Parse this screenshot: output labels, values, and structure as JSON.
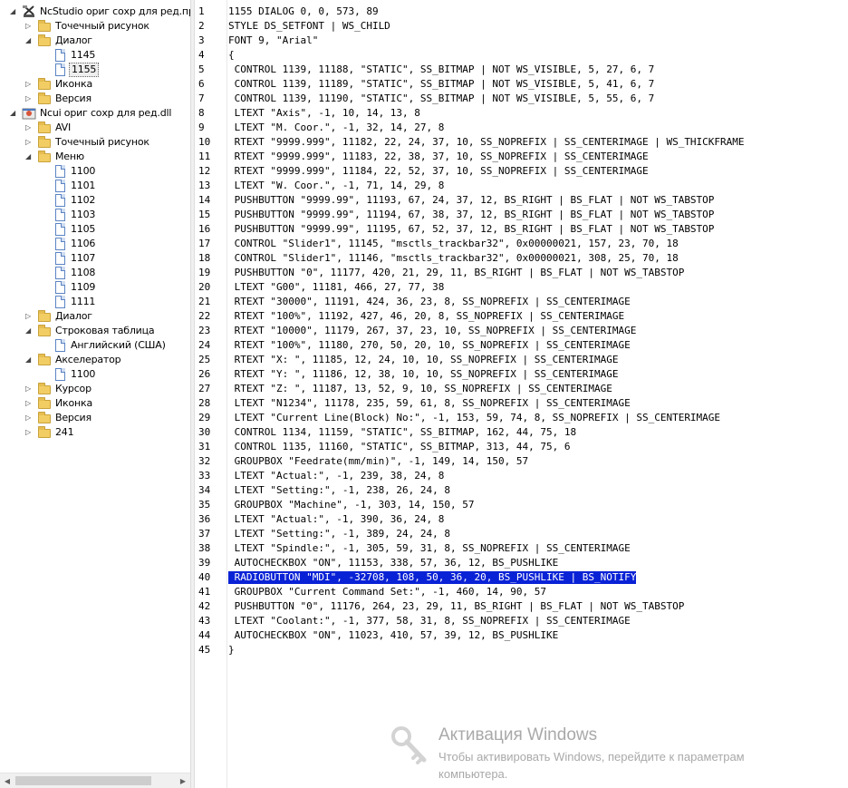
{
  "tree": {
    "items": [
      {
        "label": "NcStudio ориг сохр для ред.проб",
        "level": 0,
        "type": "app",
        "expanded": true
      },
      {
        "label": "Точечный рисунок",
        "level": 1,
        "type": "folder",
        "expanded": false
      },
      {
        "label": "Диалог",
        "level": 1,
        "type": "folder",
        "expanded": true
      },
      {
        "label": "1145",
        "level": 2,
        "type": "doc"
      },
      {
        "label": "1155",
        "level": 2,
        "type": "doc",
        "selected": true
      },
      {
        "label": "Иконка",
        "level": 1,
        "type": "folder",
        "expanded": false
      },
      {
        "label": "Версия",
        "level": 1,
        "type": "folder",
        "expanded": false
      },
      {
        "label": "Ncui ориг сохр для ред.dll",
        "level": 0,
        "type": "app2",
        "expanded": true
      },
      {
        "label": "AVI",
        "level": 1,
        "type": "folder",
        "expanded": false
      },
      {
        "label": "Точечный рисунок",
        "level": 1,
        "type": "folder",
        "expanded": false
      },
      {
        "label": "Меню",
        "level": 1,
        "type": "folder",
        "expanded": true
      },
      {
        "label": "1100",
        "level": 2,
        "type": "doc"
      },
      {
        "label": "1101",
        "level": 2,
        "type": "doc"
      },
      {
        "label": "1102",
        "level": 2,
        "type": "doc"
      },
      {
        "label": "1103",
        "level": 2,
        "type": "doc"
      },
      {
        "label": "1105",
        "level": 2,
        "type": "doc"
      },
      {
        "label": "1106",
        "level": 2,
        "type": "doc"
      },
      {
        "label": "1107",
        "level": 2,
        "type": "doc"
      },
      {
        "label": "1108",
        "level": 2,
        "type": "doc"
      },
      {
        "label": "1109",
        "level": 2,
        "type": "doc"
      },
      {
        "label": "1111",
        "level": 2,
        "type": "doc"
      },
      {
        "label": "Диалог",
        "level": 1,
        "type": "folder",
        "expanded": false
      },
      {
        "label": "Строковая таблица",
        "level": 1,
        "type": "folder",
        "expanded": true
      },
      {
        "label": "Английский (США)",
        "level": 2,
        "type": "doc"
      },
      {
        "label": "Акселератор",
        "level": 1,
        "type": "folder",
        "expanded": true
      },
      {
        "label": "1100",
        "level": 2,
        "type": "doc"
      },
      {
        "label": "Курсор",
        "level": 1,
        "type": "folder",
        "expanded": false
      },
      {
        "label": "Иконка",
        "level": 1,
        "type": "folder",
        "expanded": false
      },
      {
        "label": "Версия",
        "level": 1,
        "type": "folder",
        "expanded": false
      },
      {
        "label": "241",
        "level": 1,
        "type": "folder",
        "expanded": false
      }
    ]
  },
  "editor": {
    "selected_line": 40,
    "lines": [
      "1155 DIALOG 0, 0, 573, 89",
      "STYLE DS_SETFONT | WS_CHILD",
      "FONT 9, \"Arial\"",
      "{",
      " CONTROL 1139, 11188, \"STATIC\", SS_BITMAP | NOT WS_VISIBLE, 5, 27, 6, 7",
      " CONTROL 1139, 11189, \"STATIC\", SS_BITMAP | NOT WS_VISIBLE, 5, 41, 6, 7",
      " CONTROL 1139, 11190, \"STATIC\", SS_BITMAP | NOT WS_VISIBLE, 5, 55, 6, 7",
      " LTEXT \"Axis\", -1, 10, 14, 13, 8",
      " LTEXT \"M. Coor.\", -1, 32, 14, 27, 8",
      " RTEXT \"9999.999\", 11182, 22, 24, 37, 10, SS_NOPREFIX | SS_CENTERIMAGE | WS_THICKFRAME",
      " RTEXT \"9999.999\", 11183, 22, 38, 37, 10, SS_NOPREFIX | SS_CENTERIMAGE",
      " RTEXT \"9999.999\", 11184, 22, 52, 37, 10, SS_NOPREFIX | SS_CENTERIMAGE",
      " LTEXT \"W. Coor.\", -1, 71, 14, 29, 8",
      " PUSHBUTTON \"9999.99\", 11193, 67, 24, 37, 12, BS_RIGHT | BS_FLAT | NOT WS_TABSTOP",
      " PUSHBUTTON \"9999.99\", 11194, 67, 38, 37, 12, BS_RIGHT | BS_FLAT | NOT WS_TABSTOP",
      " PUSHBUTTON \"9999.99\", 11195, 67, 52, 37, 12, BS_RIGHT | BS_FLAT | NOT WS_TABSTOP",
      " CONTROL \"Slider1\", 11145, \"msctls_trackbar32\", 0x00000021, 157, 23, 70, 18",
      " CONTROL \"Slider1\", 11146, \"msctls_trackbar32\", 0x00000021, 308, 25, 70, 18",
      " PUSHBUTTON \"0\", 11177, 420, 21, 29, 11, BS_RIGHT | BS_FLAT | NOT WS_TABSTOP",
      " LTEXT \"G00\", 11181, 466, 27, 77, 38",
      " RTEXT \"30000\", 11191, 424, 36, 23, 8, SS_NOPREFIX | SS_CENTERIMAGE",
      " RTEXT \"100%\", 11192, 427, 46, 20, 8, SS_NOPREFIX | SS_CENTERIMAGE",
      " RTEXT \"10000\", 11179, 267, 37, 23, 10, SS_NOPREFIX | SS_CENTERIMAGE",
      " RTEXT \"100%\", 11180, 270, 50, 20, 10, SS_NOPREFIX | SS_CENTERIMAGE",
      " RTEXT \"X: \", 11185, 12, 24, 10, 10, SS_NOPREFIX | SS_CENTERIMAGE",
      " RTEXT \"Y: \", 11186, 12, 38, 10, 10, SS_NOPREFIX | SS_CENTERIMAGE",
      " RTEXT \"Z: \", 11187, 13, 52, 9, 10, SS_NOPREFIX | SS_CENTERIMAGE",
      " LTEXT \"N1234\", 11178, 235, 59, 61, 8, SS_NOPREFIX | SS_CENTERIMAGE",
      " LTEXT \"Current Line(Block) No:\", -1, 153, 59, 74, 8, SS_NOPREFIX | SS_CENTERIMAGE",
      " CONTROL 1134, 11159, \"STATIC\", SS_BITMAP, 162, 44, 75, 18",
      " CONTROL 1135, 11160, \"STATIC\", SS_BITMAP, 313, 44, 75, 6",
      " GROUPBOX \"Feedrate(mm/min)\", -1, 149, 14, 150, 57",
      " LTEXT \"Actual:\", -1, 239, 38, 24, 8",
      " LTEXT \"Setting:\", -1, 238, 26, 24, 8",
      " GROUPBOX \"Machine\", -1, 303, 14, 150, 57",
      " LTEXT \"Actual:\", -1, 390, 36, 24, 8",
      " LTEXT \"Setting:\", -1, 389, 24, 24, 8",
      " LTEXT \"Spindle:\", -1, 305, 59, 31, 8, SS_NOPREFIX | SS_CENTERIMAGE",
      " AUTOCHECKBOX \"ON\", 11153, 338, 57, 36, 12, BS_PUSHLIKE",
      " RADIOBUTTON \"MDI\", -32708, 108, 50, 36, 20, BS_PUSHLIKE | BS_NOTIFY",
      " GROUPBOX \"Current Command Set:\", -1, 460, 14, 90, 57",
      " PUSHBUTTON \"0\", 11176, 264, 23, 29, 11, BS_RIGHT | BS_FLAT | NOT WS_TABSTOP",
      " LTEXT \"Coolant:\", -1, 377, 58, 31, 8, SS_NOPREFIX | SS_CENTERIMAGE",
      " AUTOCHECKBOX \"ON\", 11023, 410, 57, 39, 12, BS_PUSHLIKE",
      "}"
    ]
  },
  "watermark": {
    "title": "Активация Windows",
    "line1": "Чтобы активировать Windows, перейдите к параметрам",
    "line2": "компьютера.",
    "icon": "key-icon"
  },
  "colors": {
    "selection": "#0a22d6",
    "folder": "#f2cd64"
  }
}
